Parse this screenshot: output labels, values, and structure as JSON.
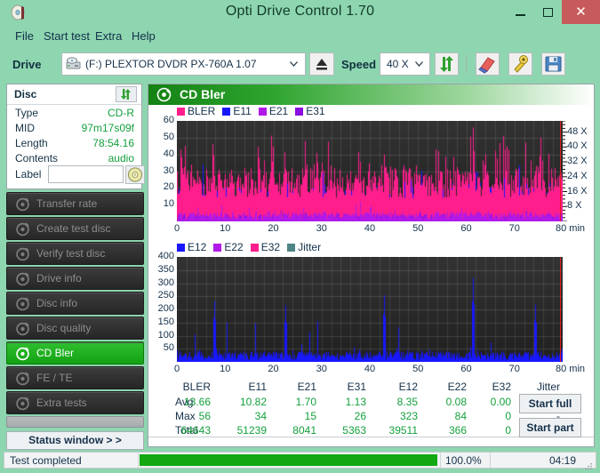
{
  "window": {
    "title": "Opti Drive Control 1.70",
    "app_icon": "disc-icon",
    "minimize": "minimize-icon",
    "maximize": "maximize-icon",
    "close": "✕"
  },
  "menu": [
    {
      "label": "File"
    },
    {
      "label": "Start test"
    },
    {
      "label": "Extra"
    },
    {
      "label": "Help"
    }
  ],
  "toolbar": {
    "drive_label": "Drive",
    "drive_value": "(F:)   PLEXTOR DVDR   PX-760A 1.07",
    "drive_icon": "drive-icon",
    "eject_icon": "eject-icon",
    "speed_label": "Speed",
    "speed_value": "40 X",
    "refresh_icon": "refresh-icon",
    "erase_icon": "erase-icon",
    "tools_icon": "tools-icon",
    "save_icon": "save-icon"
  },
  "disc": {
    "title": "Disc",
    "refresh_icon": "refresh-icon",
    "rows": [
      {
        "key": "Type",
        "value": "CD-R"
      },
      {
        "key": "MID",
        "value": "97m17s09f"
      },
      {
        "key": "Length",
        "value": "78:54.16"
      },
      {
        "key": "Contents",
        "value": "audio"
      }
    ],
    "label_key": "Label",
    "label_value": "",
    "label_placeholder": "",
    "label_icon": "cd-icon"
  },
  "nav": {
    "items": [
      {
        "label": "Transfer rate",
        "icon": "disc-test-icon",
        "active": false
      },
      {
        "label": "Create test disc",
        "icon": "disc-create-icon",
        "active": false
      },
      {
        "label": "Verify test disc",
        "icon": "disc-verify-icon",
        "active": false
      },
      {
        "label": "Drive info",
        "icon": "drive-info-icon",
        "active": false
      },
      {
        "label": "Disc info",
        "icon": "disc-info-icon",
        "active": false
      },
      {
        "label": "Disc quality",
        "icon": "disc-quality-icon",
        "active": false
      },
      {
        "label": "CD Bler",
        "icon": "cd-bler-icon",
        "active": true
      },
      {
        "label": "FE / TE",
        "icon": "fe-te-icon",
        "active": false
      },
      {
        "label": "Extra tests",
        "icon": "extra-tests-icon",
        "active": false
      }
    ],
    "status_window": "Status window > >"
  },
  "statusbar": {
    "text": "Test completed",
    "percent_label": "100.0%",
    "percent_value": 100,
    "time": "04:19",
    "grip_icon": "resize-grip-icon"
  },
  "graph_panel": {
    "title": "CD Bler",
    "icon": "cd-bler-icon"
  },
  "buttons": {
    "start_full": "Start full",
    "start_part": "Start part"
  },
  "stats": {
    "columns": [
      "BLER",
      "E11",
      "E21",
      "E31",
      "E12",
      "E22",
      "E32",
      "Jitter"
    ],
    "rows": [
      {
        "label": "Avg",
        "values": [
          "13.66",
          "10.82",
          "1.70",
          "1.13",
          "8.35",
          "0.08",
          "0.00",
          "-"
        ]
      },
      {
        "label": "Max",
        "values": [
          "56",
          "34",
          "15",
          "26",
          "323",
          "84",
          "0",
          "-"
        ]
      },
      {
        "label": "Total",
        "values": [
          "64643",
          "51239",
          "8041",
          "5363",
          "39511",
          "366",
          "0",
          ""
        ]
      }
    ]
  },
  "colors": {
    "bler": "#ff1e8c",
    "e11": "#1818ff",
    "e21": "#b019e8",
    "e31": "#8a0fe0",
    "e12": "#1818ff",
    "e22": "#b019e8",
    "e32": "#ff1e8c",
    "jitter": "#4e8585",
    "accent_green": "#14a03c",
    "titlebar": "#8ed6b0",
    "close_button": "#c75b5b",
    "plot_bg": "#2a2a2a",
    "red_marker": "#e11c1c"
  },
  "chart_data": [
    {
      "type": "area",
      "id": "cd-bler-top",
      "title": "CD Bler",
      "xlabel": "min",
      "ylabel": "",
      "xlim": [
        0,
        80
      ],
      "ylim": [
        0,
        60
      ],
      "xticks": [
        0,
        10,
        20,
        30,
        40,
        50,
        60,
        70,
        80
      ],
      "xtick_labels": [
        "0",
        "10",
        "20",
        "30",
        "40",
        "50",
        "60",
        "70",
        "80 min"
      ],
      "yticks": [
        10,
        20,
        30,
        40,
        50,
        60
      ],
      "right_axis_label": "X",
      "right_ticks": [
        8,
        16,
        24,
        32,
        40,
        48
      ],
      "right_tick_labels": [
        "8 X",
        "16 X",
        "24 X",
        "32 X",
        "40 X",
        "48 X"
      ],
      "right_ylim": [
        0,
        54
      ],
      "grid": true,
      "legend": [
        "BLER",
        "E11",
        "E21",
        "E31"
      ],
      "legend_position": "top-left",
      "series": [
        {
          "name": "BLER",
          "color": "#ff1e8c",
          "avg": 13.66,
          "max": 56,
          "total": 64643,
          "baseline": 22,
          "noise": 9,
          "spike_chance": 0.1,
          "spike_scale": 22
        },
        {
          "name": "E11",
          "color": "#1818ff",
          "avg": 10.82,
          "max": 34,
          "total": 51239,
          "baseline": 13,
          "noise": 7,
          "spike_chance": 0.05,
          "spike_scale": 14
        },
        {
          "name": "E21",
          "color": "#b019e8",
          "avg": 1.7,
          "max": 15,
          "total": 8041,
          "baseline": 3,
          "noise": 2.5,
          "spike_chance": 0.03,
          "spike_scale": 7
        },
        {
          "name": "E31",
          "color": "#8a0fe0",
          "avg": 1.13,
          "max": 26,
          "total": 5363,
          "baseline": 2,
          "noise": 2,
          "spike_chance": 0.02,
          "spike_scale": 6
        }
      ],
      "marker_x": 80
    },
    {
      "type": "area",
      "id": "cd-bler-bottom",
      "title": "",
      "xlabel": "min",
      "ylabel": "",
      "xlim": [
        0,
        80
      ],
      "ylim": [
        0,
        400
      ],
      "xticks": [
        0,
        10,
        20,
        30,
        40,
        50,
        60,
        70,
        80
      ],
      "xtick_labels": [
        "0",
        "10",
        "20",
        "30",
        "40",
        "50",
        "60",
        "70",
        "80 min"
      ],
      "yticks": [
        50,
        100,
        150,
        200,
        250,
        300,
        350,
        400
      ],
      "grid": true,
      "legend": [
        "E12",
        "E22",
        "E32",
        "Jitter"
      ],
      "legend_position": "top-left",
      "series": [
        {
          "name": "E12",
          "color": "#1818ff",
          "avg": 8.35,
          "max": 323,
          "total": 39511,
          "baseline": 22,
          "noise": 16,
          "spike_chance": 0.05,
          "spike_scale": 150
        },
        {
          "name": "E22",
          "color": "#b019e8",
          "avg": 0.08,
          "max": 84,
          "total": 366,
          "baseline": 0,
          "noise": 0.5,
          "spike_chance": 0.004,
          "spike_scale": 20
        },
        {
          "name": "E32",
          "color": "#ff1e8c",
          "avg": 0.0,
          "max": 0,
          "total": 0,
          "baseline": 0,
          "noise": 0,
          "spike_chance": 0,
          "spike_scale": 0
        },
        {
          "name": "Jitter",
          "color": "#4e8585",
          "avg": null,
          "max": null,
          "total": null,
          "baseline": 0,
          "noise": 0,
          "spike_chance": 0,
          "spike_scale": 0
        }
      ],
      "marker_x": 80,
      "peak_annotations": [
        {
          "x": 61.3,
          "y": 321
        },
        {
          "x": 43.0,
          "y": 253
        },
        {
          "x": 7.8,
          "y": 231
        },
        {
          "x": 22.4,
          "y": 216
        },
        {
          "x": 74.2,
          "y": 219
        }
      ]
    }
  ]
}
